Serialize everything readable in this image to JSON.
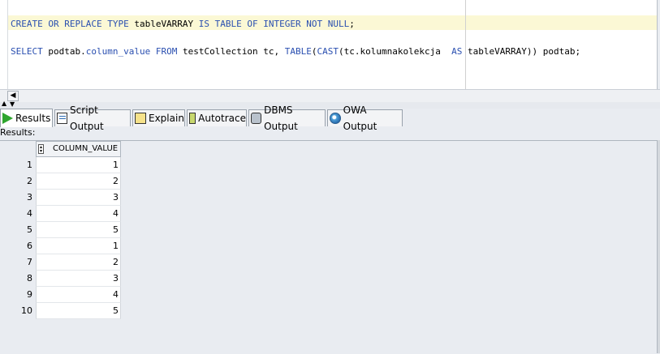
{
  "editor": {
    "line1": {
      "kw1": "CREATE OR REPLACE TYPE",
      "t1": " tableVARRAY ",
      "kw2": "IS TABLE OF INTEGER NOT NULL",
      "t2": ";"
    },
    "line2": {
      "kw1": "SELECT",
      "t1": " podtab.",
      "kw2": "column_value",
      "t2": " ",
      "kw3": "FROM",
      "t3": " testCollection tc, ",
      "kw4": "TABLE",
      "t4": "(",
      "kw5": "CAST",
      "t5": "(tc.kolumnakolekcja  ",
      "kw6": "AS",
      "t6": " tableVARRAY)) podtab;"
    }
  },
  "tabs": [
    {
      "label": "Results",
      "icon": "play-icon"
    },
    {
      "label": "Script Output",
      "icon": "script-icon"
    },
    {
      "label": "Explain",
      "icon": "explain-icon"
    },
    {
      "label": "Autotrace",
      "icon": "autotrace-icon"
    },
    {
      "label": "DBMS Output",
      "icon": "dbms-icon"
    },
    {
      "label": "OWA Output",
      "icon": "owa-icon"
    }
  ],
  "results": {
    "label": "Results:",
    "column": "COLUMN_VALUE",
    "rows": [
      {
        "n": "1",
        "v": "1"
      },
      {
        "n": "2",
        "v": "2"
      },
      {
        "n": "3",
        "v": "3"
      },
      {
        "n": "4",
        "v": "4"
      },
      {
        "n": "5",
        "v": "5"
      },
      {
        "n": "6",
        "v": "1"
      },
      {
        "n": "7",
        "v": "2"
      },
      {
        "n": "8",
        "v": "3"
      },
      {
        "n": "9",
        "v": "4"
      },
      {
        "n": "10",
        "v": "5"
      }
    ]
  },
  "colors": {
    "keyword": "#2a4fb0",
    "current_line": "#fbf8d5",
    "background": "#e9ecf1"
  }
}
